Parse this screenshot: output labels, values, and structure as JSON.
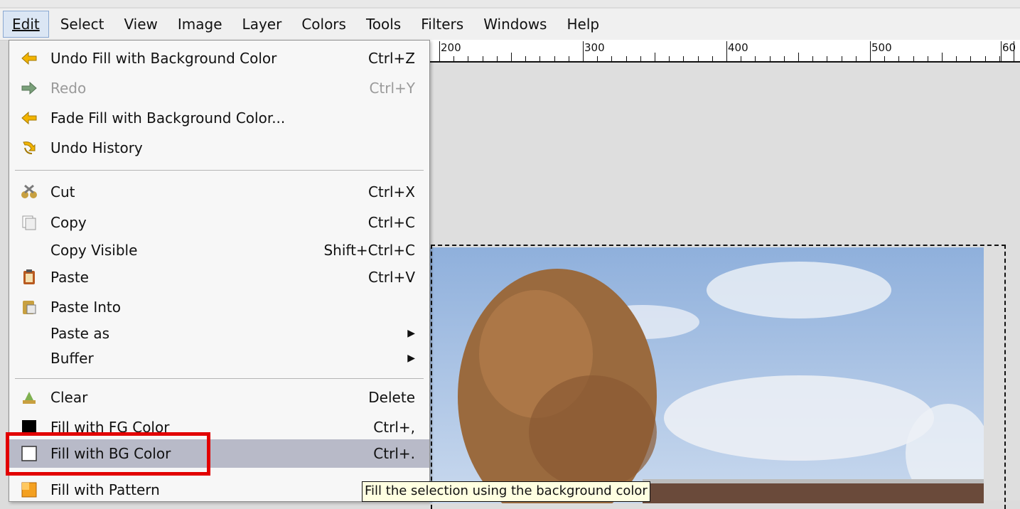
{
  "menubar": {
    "items": [
      {
        "label": "Edit",
        "active": true
      },
      {
        "label": "Select"
      },
      {
        "label": "View"
      },
      {
        "label": "Image"
      },
      {
        "label": "Layer"
      },
      {
        "label": "Colors"
      },
      {
        "label": "Tools"
      },
      {
        "label": "Filters"
      },
      {
        "label": "Windows"
      },
      {
        "label": "Help"
      }
    ]
  },
  "ruler": {
    "labels": [
      "200",
      "300",
      "400",
      "500",
      "60"
    ]
  },
  "edit_menu": {
    "items": [
      {
        "label": "Undo Fill with Background Color",
        "shortcut": "Ctrl+Z",
        "icon": "undo-arrow-icon"
      },
      {
        "label": "Redo",
        "shortcut": "Ctrl+Y",
        "icon": "redo-arrow-icon",
        "disabled": true
      },
      {
        "label": "Fade Fill with Background Color...",
        "shortcut": "",
        "icon": "fade-arrow-icon"
      },
      {
        "label": "Undo History",
        "shortcut": "",
        "icon": "undo-history-icon"
      },
      {
        "label": "Cut",
        "shortcut": "Ctrl+X",
        "icon": "scissors-icon"
      },
      {
        "label": "Copy",
        "shortcut": "Ctrl+C",
        "icon": "copy-icon"
      },
      {
        "label": "Copy Visible",
        "shortcut": "Shift+Ctrl+C",
        "icon": ""
      },
      {
        "label": "Paste",
        "shortcut": "Ctrl+V",
        "icon": "clipboard-icon"
      },
      {
        "label": "Paste Into",
        "shortcut": "",
        "icon": "paste-into-icon"
      },
      {
        "label": "Paste as",
        "shortcut": "",
        "submenu": true
      },
      {
        "label": "Buffer",
        "shortcut": "",
        "submenu": true
      },
      {
        "label": "Clear",
        "shortcut": "Delete",
        "icon": "eraser-icon"
      },
      {
        "label": "Fill with FG Color",
        "shortcut": "Ctrl+,",
        "icon": "fg-color-swatch-icon"
      },
      {
        "label": "Fill with BG Color",
        "shortcut": "Ctrl+.",
        "icon": "bg-color-swatch-icon",
        "highlighted": true
      },
      {
        "label": "Fill with Pattern",
        "shortcut": "",
        "icon": "pattern-icon"
      }
    ]
  },
  "tooltip": "Fill the selection using the background color",
  "colors": {
    "highlight": "#b8bac8",
    "annotation_box": "#e20000",
    "tooltip_bg": "#ffffe1"
  }
}
